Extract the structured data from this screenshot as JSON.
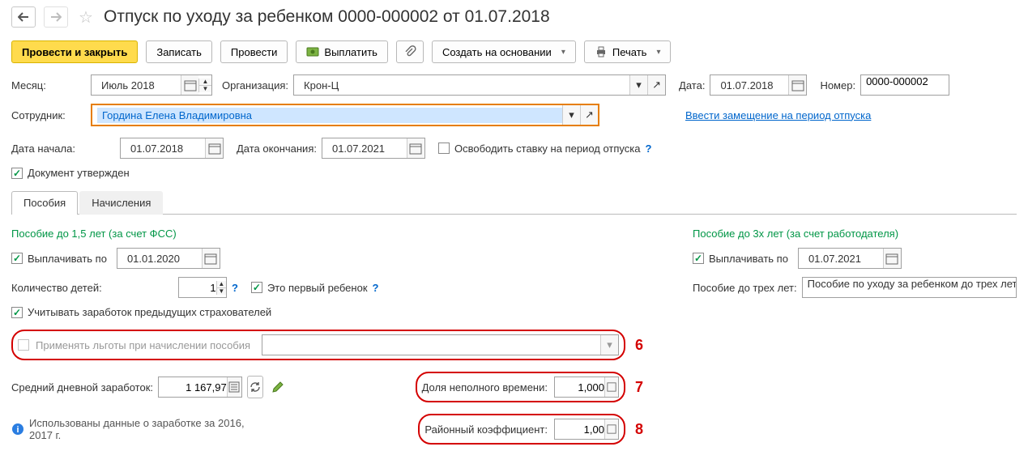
{
  "header": {
    "title": "Отпуск по уходу за ребенком 0000-000002 от 01.07.2018"
  },
  "toolbar": {
    "post_close": "Провести и закрыть",
    "save": "Записать",
    "post": "Провести",
    "pay": "Выплатить",
    "create_on_basis": "Создать на основании",
    "print": "Печать"
  },
  "fields": {
    "month_lbl": "Месяц:",
    "month_val": "Июль 2018",
    "org_lbl": "Организация:",
    "org_val": "Крон-Ц",
    "date_lbl": "Дата:",
    "date_val": "01.07.2018",
    "number_lbl": "Номер:",
    "number_val": "0000-000002",
    "employee_lbl": "Сотрудник:",
    "employee_val": "Гордина Елена Владимировна",
    "substitution_link": "Ввести замещение на период отпуска",
    "start_lbl": "Дата начала:",
    "start_val": "01.07.2018",
    "end_lbl": "Дата окончания:",
    "end_val": "01.07.2021",
    "free_rate_lbl": "Освободить ставку на период отпуска",
    "approved_lbl": "Документ утвержден"
  },
  "tabs": {
    "t1": "Пособия",
    "t2": "Начисления"
  },
  "left": {
    "title": "Пособие до 1,5 лет (за счет ФСС)",
    "pay_until_lbl": "Выплачивать по",
    "pay_until_val": "01.01.2020",
    "children_lbl": "Количество детей:",
    "children_val": "1",
    "first_child_lbl": "Это первый ребенок",
    "prev_employers_lbl": "Учитывать заработок предыдущих страхователей",
    "apply_benefits_lbl": "Применять льготы при начислении пособия",
    "avg_daily_lbl": "Средний дневной заработок:",
    "avg_daily_val": "1 167,97",
    "info_txt": "Использованы данные о заработке за  2016,  2017 г.",
    "part_time_lbl": "Доля неполного времени:",
    "part_time_val": "1,000",
    "region_coef_lbl": "Районный коэффициент:",
    "region_coef_val": "1,00"
  },
  "right": {
    "title": "Пособие до 3х лет (за счет работодателя)",
    "pay_until_lbl": "Выплачивать по",
    "pay_until_val": "01.07.2021",
    "type_lbl": "Пособие до трех лет:",
    "type_val": "Пособие по уходу за ребенком до трех лет"
  },
  "annotations": {
    "n6": "6",
    "n7": "7",
    "n8": "8"
  }
}
